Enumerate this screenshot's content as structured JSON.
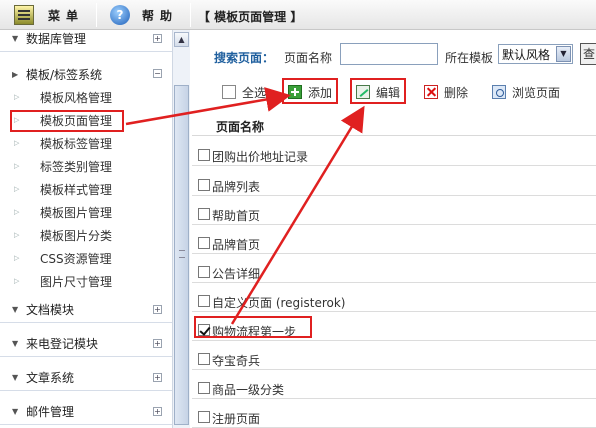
{
  "topbar": {
    "menu_label": "菜单",
    "help_label": "帮助",
    "page_title": "【 模板页面管理 】",
    "menu_icon": "menu-icon",
    "help_icon": "help-icon"
  },
  "sidebar": {
    "groups": [
      {
        "label": "数据库管理",
        "toggle": "+"
      },
      {
        "label": "模板/标签系统",
        "toggle": "−"
      },
      {
        "label": "文档模块",
        "toggle": "+"
      },
      {
        "label": "来电登记模块",
        "toggle": "+"
      },
      {
        "label": "文章系统",
        "toggle": "+"
      },
      {
        "label": "邮件管理",
        "toggle": "+"
      }
    ],
    "items": [
      {
        "label": "模板风格管理"
      },
      {
        "label": "模板页面管理"
      },
      {
        "label": "模板标签管理"
      },
      {
        "label": "标签类别管理"
      },
      {
        "label": "模板样式管理"
      },
      {
        "label": "模板图片管理"
      },
      {
        "label": "模板图片分类"
      },
      {
        "label": "CSS资源管理"
      },
      {
        "label": "图片尺寸管理"
      }
    ]
  },
  "search": {
    "label": "搜索页面：",
    "name_label": "页面名称",
    "name_value": "",
    "template_label": "所在模板",
    "template_value": "默认风格",
    "button_label": "查询"
  },
  "toolbar": {
    "select_all": "全选",
    "add": "添加",
    "edit": "编辑",
    "delete": "删除",
    "browse": "浏览页面"
  },
  "table": {
    "header": "页面名称",
    "rows": [
      {
        "name": "团购出价地址记录",
        "checked": false
      },
      {
        "name": "品牌列表",
        "checked": false
      },
      {
        "name": "帮助首页",
        "checked": false
      },
      {
        "name": "品牌首页",
        "checked": false
      },
      {
        "name": "公告详细",
        "checked": false
      },
      {
        "name": "自定义页面 (registerok)",
        "checked": false
      },
      {
        "name": "购物流程第一步",
        "checked": true
      },
      {
        "name": "夺宝奇兵",
        "checked": false
      },
      {
        "name": "商品一级分类",
        "checked": false
      },
      {
        "name": "注册页面",
        "checked": false
      }
    ]
  },
  "annotation_color": "#e02020"
}
